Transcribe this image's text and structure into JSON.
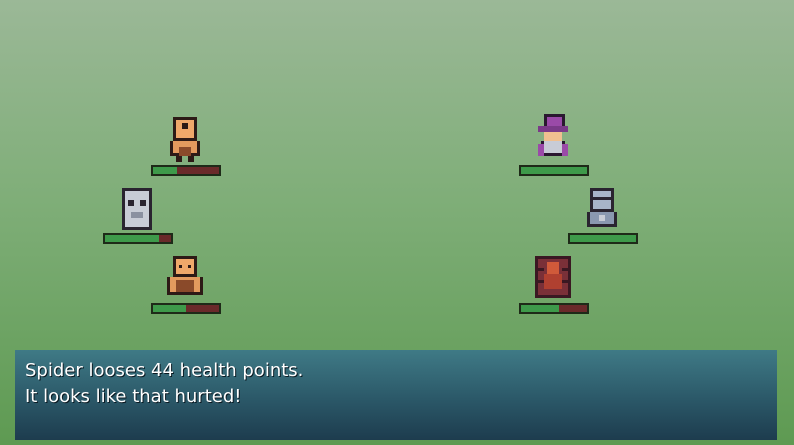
{
  "battle": {
    "party": [
      {
        "name": "cyclops",
        "icon": "cyclops-icon",
        "hp_fraction": 0.36
      },
      {
        "name": "ghost",
        "icon": "ghost-icon",
        "hp_fraction": 0.82
      },
      {
        "name": "brawler",
        "icon": "brawler-icon",
        "hp_fraction": 0.5
      }
    ],
    "enemies": [
      {
        "name": "wizard",
        "icon": "wizard-icon",
        "hp_fraction": 1.0
      },
      {
        "name": "knight",
        "icon": "knight-icon",
        "hp_fraction": 1.0
      },
      {
        "name": "spider",
        "icon": "spider-icon",
        "hp_fraction": 0.58
      }
    ]
  },
  "dialog": {
    "line1": "Spider looses 44 health points.",
    "line2": "It looks like that hurted!"
  },
  "colors": {
    "hp_fill": "#3e9a4a",
    "hp_empty": "#6a2a2a",
    "dialog_bg": "#2b5868"
  }
}
